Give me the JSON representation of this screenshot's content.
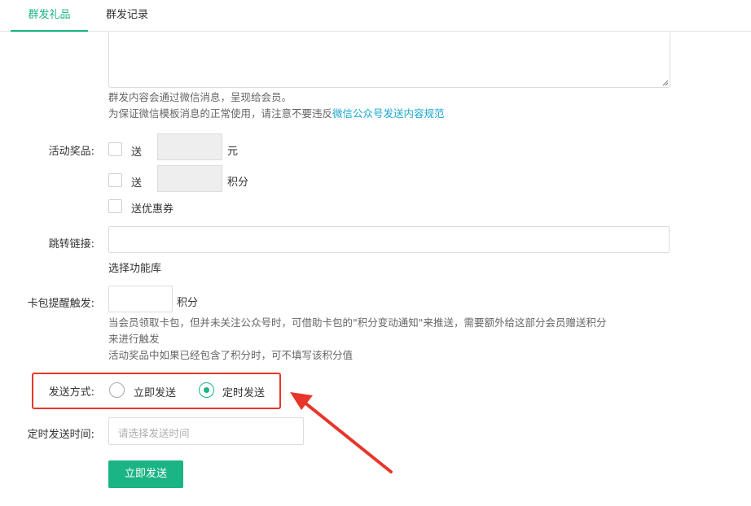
{
  "tabs": [
    "群发礼品",
    "群发记录"
  ],
  "content": {
    "help_line1": "群发内容会通过微信消息，呈现给会员。",
    "help_line2_prefix": "为保证微信模板消息的正常使用，请注意不要违反",
    "help_line2_link": "微信公众号发送内容规范"
  },
  "prize": {
    "label": "活动奖品:",
    "option1_prefix": "送",
    "option1_unit": "元",
    "option2_prefix": "送",
    "option2_unit": "积分",
    "option3": "送优惠券"
  },
  "jump_link": {
    "label": "跳转链接:",
    "value": "",
    "select_link": "选择功能库"
  },
  "card_trigger": {
    "label": "卡包提醒触发:",
    "value": "",
    "unit": "积分",
    "help_line1": "当会员领取卡包，但并未关注公众号时，可借助卡包的\"积分变动通知\"来推送，需要额外给这部分会员赠送积分",
    "help_line2": "来进行触发",
    "help_line3": "活动奖品中如果已经包含了积分时，可不填写该积分值"
  },
  "send_mode": {
    "label": "发送方式:",
    "options": [
      "立即发送",
      "定时发送"
    ],
    "selected": "定时发送"
  },
  "schedule": {
    "label": "定时发送时间:",
    "placeholder": "请选择发送时间"
  },
  "submit_label": "立即发送",
  "colors": {
    "accent": "#1bb485",
    "link": "#1aa6cf",
    "annotation_red": "#e8352b"
  }
}
